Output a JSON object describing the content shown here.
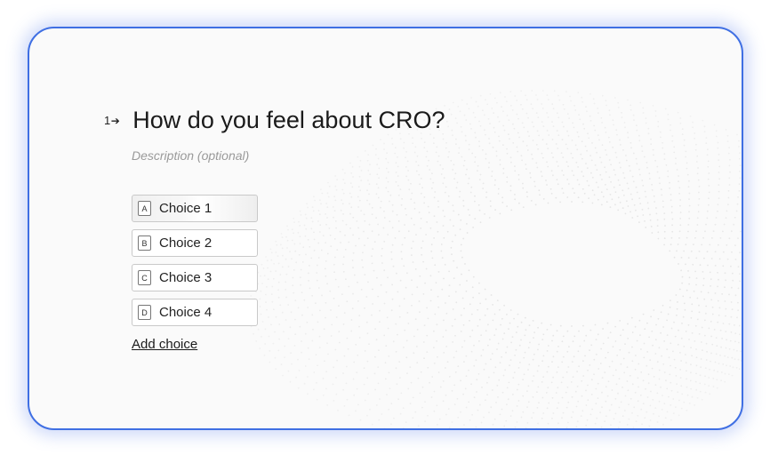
{
  "question": {
    "number": "1",
    "title": "How do you feel about CRO?",
    "description_placeholder": "Description (optional)"
  },
  "choices": [
    {
      "key": "A",
      "label": "Choice 1"
    },
    {
      "key": "B",
      "label": "Choice 2"
    },
    {
      "key": "C",
      "label": "Choice 3"
    },
    {
      "key": "D",
      "label": "Choice 4"
    }
  ],
  "add_choice_label": "Add choice",
  "colors": {
    "accent_border": "#3f6fe3",
    "text": "#1b1b1b",
    "muted": "#9a9a9a"
  },
  "icons": {
    "question_arrow": "arrow-right-icon"
  }
}
